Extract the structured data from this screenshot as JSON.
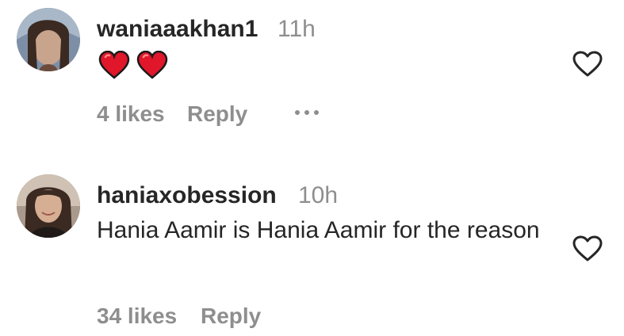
{
  "comments": [
    {
      "username": "waniaaakhan1",
      "time": "11h",
      "text": "",
      "emoji_text": "❤️❤️",
      "likes": "4 likes",
      "reply": "Reply",
      "avatar_icon": "user-avatar-icon",
      "like_icon": "heart-outline-icon",
      "more_icon": "more-options-icon"
    },
    {
      "username": "haniaxobession",
      "time": "10h",
      "text": "Hania Aamir is Hania Aamir for the reason",
      "likes": "34 likes",
      "reply": "Reply",
      "avatar_icon": "user-avatar-icon",
      "like_icon": "heart-outline-icon"
    }
  ],
  "colors": {
    "primary_text": "#262626",
    "secondary_text": "#8e8e8e",
    "heart_red": "#e0162b"
  }
}
